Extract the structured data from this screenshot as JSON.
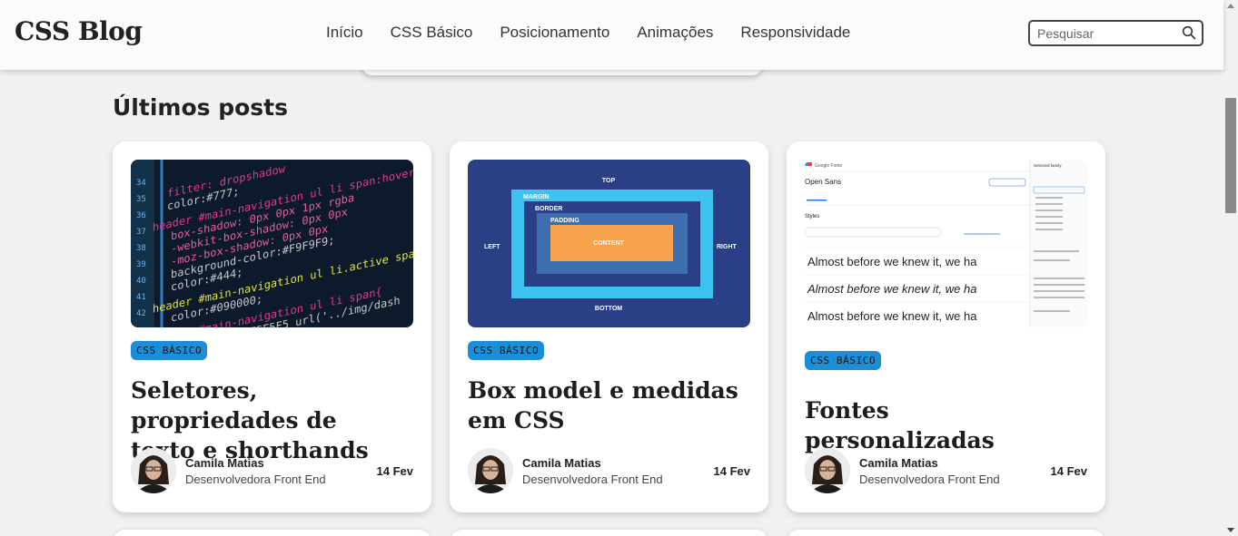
{
  "header": {
    "logo": "CSS Blog",
    "nav": [
      "Início",
      "CSS Básico",
      "Posicionamento",
      "Animações",
      "Responsividade"
    ],
    "search_placeholder": "Pesquisar"
  },
  "main": {
    "section_title": "Últimos posts",
    "posts": [
      {
        "category": "CSS BÁSICO",
        "title": "Seletores, propriedades de texto e shorthands",
        "author": "Camila Matias",
        "role": "Desenvolvedora Front End",
        "date": "14 Fev"
      },
      {
        "category": "CSS BÁSICO",
        "title": "Box model e medidas em CSS",
        "author": "Camila Matias",
        "role": "Desenvolvedora Front End",
        "date": "14 Fev"
      },
      {
        "category": "CSS BÁSICO",
        "title": "Fontes personalizadas",
        "author": "Camila Matias",
        "role": "Desenvolvedora Front End",
        "date": "14 Fev"
      }
    ],
    "box_model": {
      "top": "TOP",
      "bottom": "BOTTOM",
      "left": "LEFT",
      "right": "RIGHT",
      "margin": "MARGIN",
      "border": "BORDER",
      "padding": "PADDING",
      "content": "CONTENT"
    },
    "google_fonts": {
      "brand": "Google Fonts",
      "font_name": "Open Sans",
      "sample": "Almost before we knew it, we ha",
      "panel_title": "Selected family",
      "styles_label": "Styles"
    }
  },
  "colors": {
    "accent": "#1a8fd8",
    "header_bg": "#fbfbfb",
    "page_bg": "#f1f1f1"
  }
}
